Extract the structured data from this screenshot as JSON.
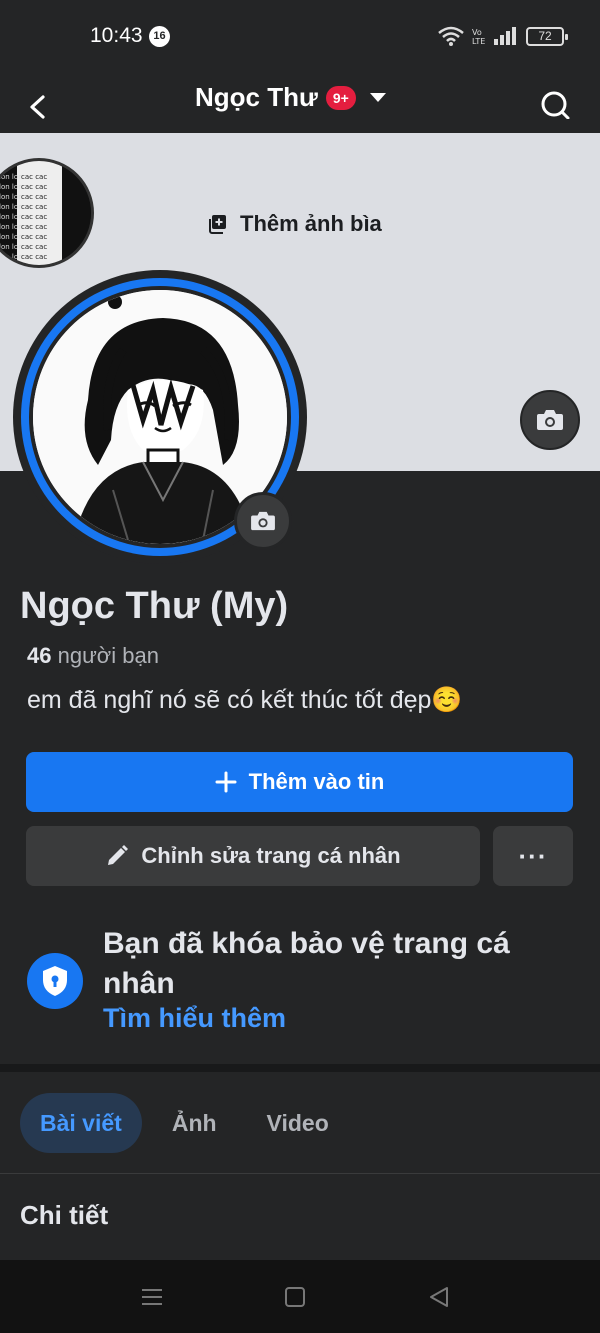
{
  "status": {
    "time": "10:43",
    "badge": "16",
    "battery": "72"
  },
  "header": {
    "title": "Ngọc Thư",
    "notifications": "9+"
  },
  "cover": {
    "add_cover_label": "Thêm ảnh bìa",
    "mini_avatar_text": "lon lon cac cac cac lon lon lon cac cac cac lon lon"
  },
  "profile": {
    "name": "Ngọc Thư (My)",
    "friends_count": "46",
    "friends_label": "người bạn",
    "bio": "em đã nghĩ nó sẽ có kết thúc tốt đẹp☺️"
  },
  "actions": {
    "add_story": "Thêm vào tin",
    "edit_profile": "Chỉnh sửa trang cá nhân",
    "more": "···"
  },
  "lock_notice": {
    "title": "Bạn đã khóa bảo vệ trang cá nhân",
    "link": "Tìm hiểu thêm"
  },
  "tabs": [
    {
      "label": "Bài viết",
      "active": true
    },
    {
      "label": "Ảnh",
      "active": false
    },
    {
      "label": "Video",
      "active": false
    }
  ],
  "details_heading": "Chi tiết",
  "colors": {
    "accent": "#1877f2",
    "link": "#4599ff",
    "background": "#242526"
  }
}
